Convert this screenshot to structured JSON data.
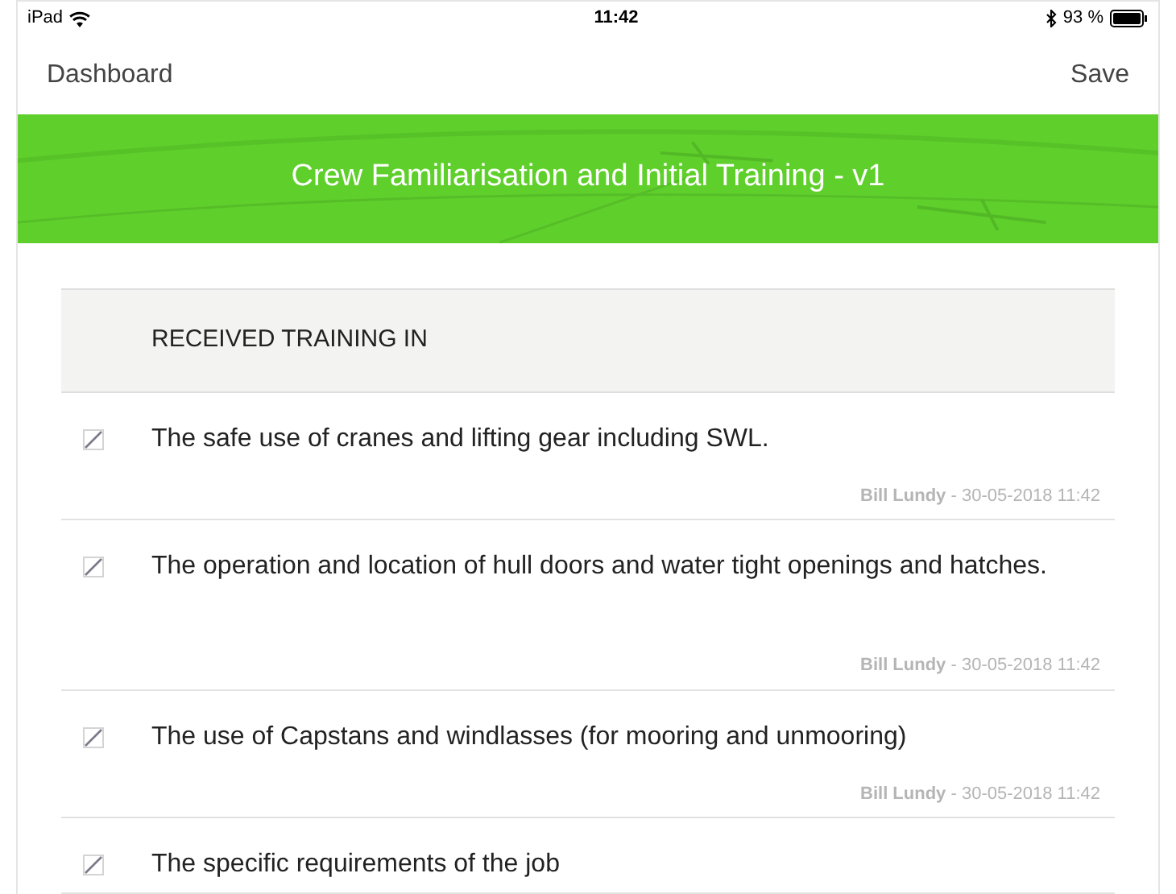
{
  "status_bar": {
    "device": "iPad",
    "time": "11:42",
    "battery": "93 %"
  },
  "nav_bar": {
    "back": "Dashboard",
    "action": "Save"
  },
  "banner": {
    "title": "Crew Familiarisation and Initial Training - v1"
  },
  "section": {
    "heading": "RECEIVED TRAINING IN"
  },
  "items": [
    {
      "text": "The safe use of cranes and lifting gear including SWL.",
      "checked": true,
      "author": "Bill Lundy",
      "timestamp": " - 30-05-2018 11:42"
    },
    {
      "text": "The operation and location of hull doors and water tight openings and hatches.",
      "checked": true,
      "author": "Bill Lundy",
      "timestamp": " - 30-05-2018 11:42"
    },
    {
      "text": "The use of Capstans and windlasses (for mooring and unmooring)",
      "checked": true,
      "author": "Bill Lundy",
      "timestamp": " - 30-05-2018 11:42"
    },
    {
      "text": "The specific requirements of the job",
      "checked": true
    }
  ]
}
